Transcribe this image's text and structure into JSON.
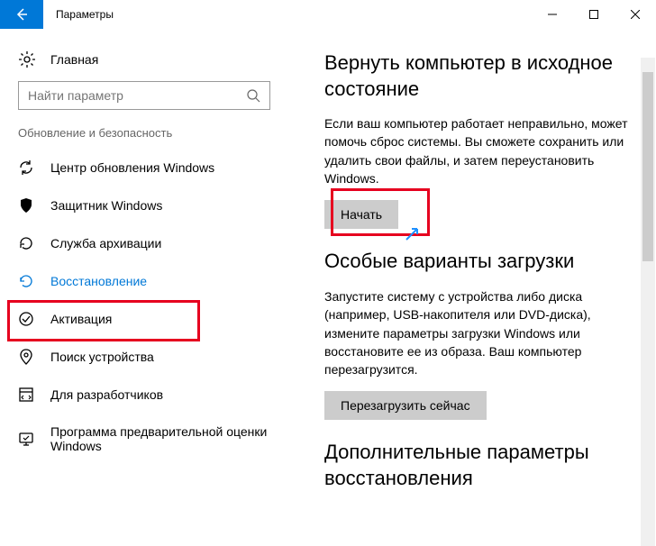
{
  "window": {
    "title": "Параметры"
  },
  "sidebar": {
    "home": "Главная",
    "search_placeholder": "Найти параметр",
    "section": "Обновление и безопасность",
    "items": [
      {
        "label": "Центр обновления Windows"
      },
      {
        "label": "Защитник Windows"
      },
      {
        "label": "Служба архивации"
      },
      {
        "label": "Восстановление"
      },
      {
        "label": "Активация"
      },
      {
        "label": "Поиск устройства"
      },
      {
        "label": "Для разработчиков"
      },
      {
        "label": "Программа предварительной оценки Windows"
      }
    ]
  },
  "main": {
    "reset_title": "Вернуть компьютер в исходное состояние",
    "reset_text": "Если ваш компьютер работает неправильно, может помочь сброс системы. Вы сможете сохранить или удалить свои файлы, и затем переустановить Windows.",
    "reset_button": "Начать",
    "advanced_title": "Особые варианты загрузки",
    "advanced_text": "Запустите систему с устройства либо диска (например, USB-накопителя или DVD-диска), измените параметры загрузки Windows или восстановите ее из образа. Ваш компьютер перезагрузится.",
    "advanced_button": "Перезагрузить сейчас",
    "more_title": "Дополнительные параметры восстановления"
  }
}
